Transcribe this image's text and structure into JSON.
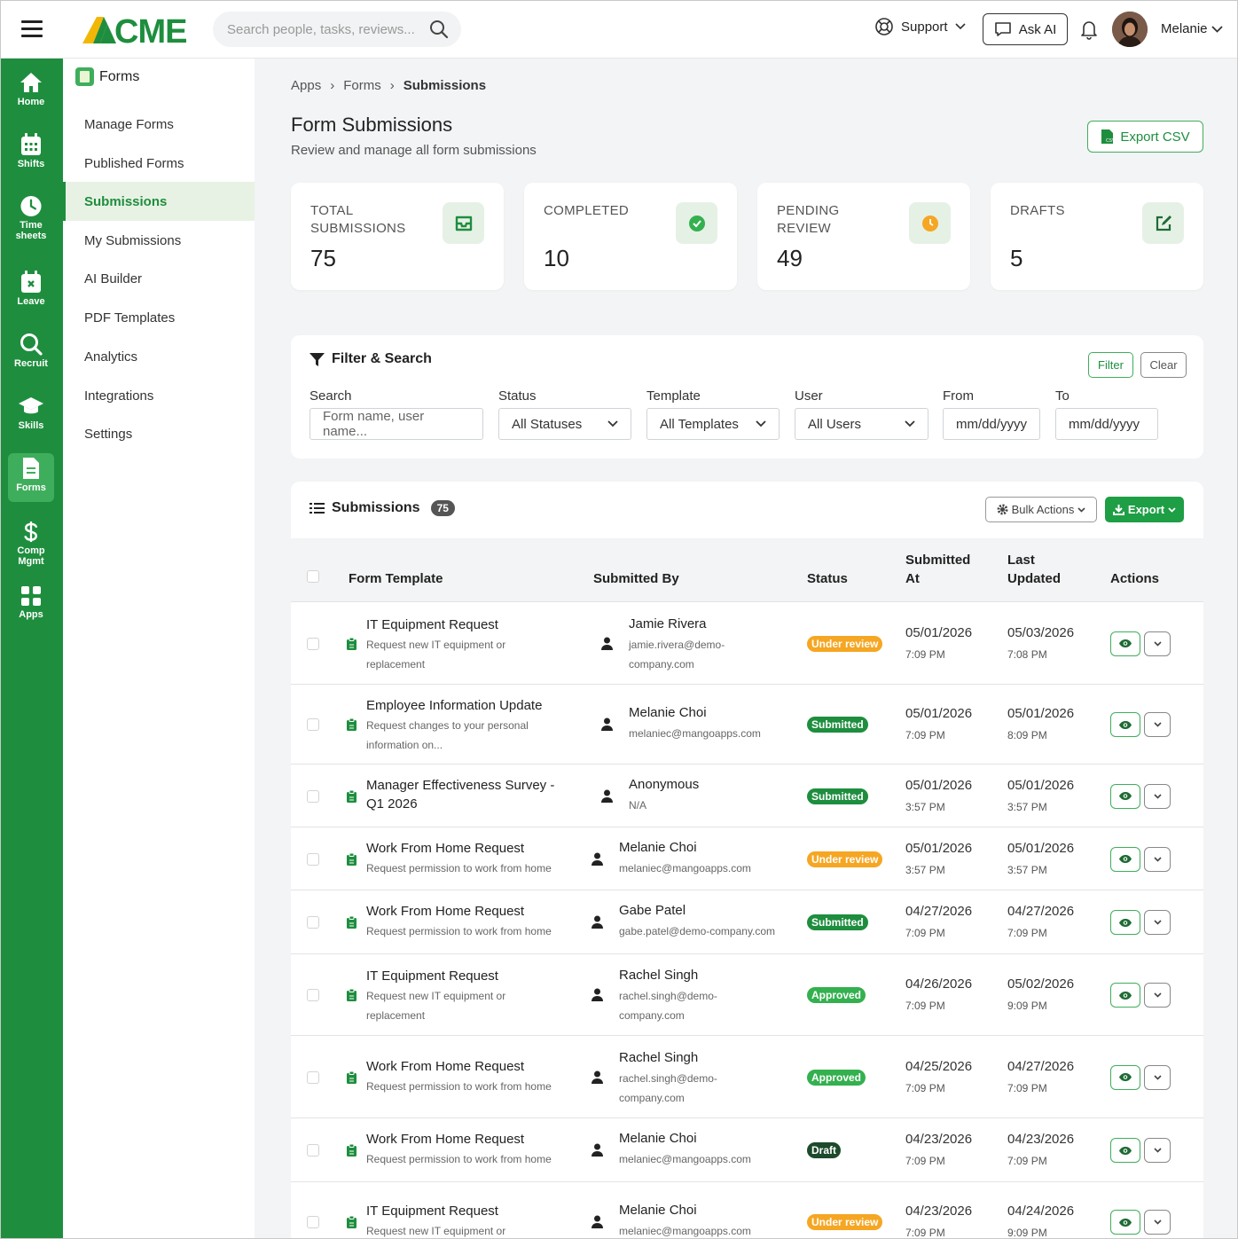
{
  "brand": {
    "logo_text": "ACME"
  },
  "topbar": {
    "search_placeholder": "Search people, tasks, reviews...",
    "support_label": "Support",
    "ask_ai_label": "Ask AI",
    "user_name": "Melanie"
  },
  "rail": [
    {
      "label": "Home",
      "icon": "home-icon"
    },
    {
      "label": "Shifts",
      "icon": "calendar-icon"
    },
    {
      "label": "Time sheets",
      "icon": "clock-icon"
    },
    {
      "label": "Leave",
      "icon": "calendar-x-icon"
    },
    {
      "label": "Recruit",
      "icon": "search-icon"
    },
    {
      "label": "Skills",
      "icon": "graduation-cap-icon"
    },
    {
      "label": "Forms",
      "icon": "form-icon",
      "active": true
    },
    {
      "label": "Comp Mgmt",
      "icon": "dollar-icon"
    },
    {
      "label": "Apps",
      "icon": "grid-icon"
    }
  ],
  "sidebar": {
    "title": "Forms",
    "items": [
      {
        "label": "Manage Forms"
      },
      {
        "label": "Published Forms"
      },
      {
        "label": "Submissions",
        "active": true
      },
      {
        "label": "My Submissions"
      },
      {
        "label": "AI Builder"
      },
      {
        "label": "PDF Templates"
      },
      {
        "label": "Analytics"
      },
      {
        "label": "Integrations"
      },
      {
        "label": "Settings"
      }
    ]
  },
  "breadcrumb": [
    "Apps",
    "Forms",
    "Submissions"
  ],
  "page": {
    "title": "Form Submissions",
    "subtitle": "Review and manage all form submissions",
    "export_csv_label": "Export CSV"
  },
  "stats": [
    {
      "label": "TOTAL SUBMISSIONS",
      "value": "75",
      "icon": "inbox-icon",
      "color": "#1e8e3e"
    },
    {
      "label": "COMPLETED",
      "value": "10",
      "icon": "check-circle-icon",
      "color": "#34b04f"
    },
    {
      "label": "PENDING REVIEW",
      "value": "49",
      "icon": "clock-icon",
      "color": "#f5a623"
    },
    {
      "label": "DRAFTS",
      "value": "5",
      "icon": "edit-icon",
      "color": "#1e6b34"
    }
  ],
  "filter": {
    "title": "Filter & Search",
    "filter_button": "Filter",
    "clear_button": "Clear",
    "search_label": "Search",
    "search_placeholder": "Form name, user name...",
    "status_label": "Status",
    "status_value": "All Statuses",
    "template_label": "Template",
    "template_value": "All Templates",
    "user_label": "User",
    "user_value": "All Users",
    "from_label": "From",
    "from_placeholder": "mm/dd/yyyy",
    "to_label": "To",
    "to_placeholder": "mm/dd/yyyy"
  },
  "submissions": {
    "title": "Submissions",
    "count": "75",
    "bulk_actions_label": "Bulk Actions",
    "export_label": "Export",
    "columns": {
      "form_template": "Form Template",
      "submitted_by": "Submitted By",
      "status": "Status",
      "submitted_at_1": "Submitted",
      "submitted_at_2": "At",
      "last_updated_1": "Last",
      "last_updated_2": "Updated",
      "actions": "Actions"
    },
    "rows": [
      {
        "title": "IT Equipment Request",
        "desc1": "Request new IT equipment or",
        "desc2": "replacement",
        "user": "Jamie Rivera",
        "email1": "jamie.rivera@demo-",
        "email2": "company.com",
        "status": "Under review",
        "status_kind": "review",
        "sub_date": "05/01/2026",
        "sub_time": "7:09 PM",
        "upd_date": "05/03/2026",
        "upd_time": "7:08 PM"
      },
      {
        "title": "Employee Information Update",
        "desc1": "Request changes to your personal",
        "desc2": "information on...",
        "user": "Melanie Choi",
        "email1": "melaniec@mangoapps.com",
        "email2": "",
        "status": "Submitted",
        "status_kind": "submitted",
        "sub_date": "05/01/2026",
        "sub_time": "7:09 PM",
        "upd_date": "05/01/2026",
        "upd_time": "8:09 PM"
      },
      {
        "title": "Manager Effectiveness Survey -",
        "title2": "Q1 2026",
        "desc1": "",
        "desc2": "",
        "user": "Anonymous",
        "email1": "N/A",
        "email2": "",
        "status": "Submitted",
        "status_kind": "submitted",
        "sub_date": "05/01/2026",
        "sub_time": "3:57 PM",
        "upd_date": "05/01/2026",
        "upd_time": "3:57 PM"
      },
      {
        "title": "Work From Home Request",
        "desc1": "Request permission to work from home",
        "desc2": "",
        "user": "Melanie Choi",
        "email1": "melaniec@mangoapps.com",
        "email2": "",
        "status": "Under review",
        "status_kind": "review",
        "sub_date": "05/01/2026",
        "sub_time": "3:57 PM",
        "upd_date": "05/01/2026",
        "upd_time": "3:57 PM"
      },
      {
        "title": "Work From Home Request",
        "desc1": "Request permission to work from home",
        "desc2": "",
        "user": "Gabe Patel",
        "email1": "gabe.patel@demo-company.com",
        "email2": "",
        "status": "Submitted",
        "status_kind": "submitted",
        "sub_date": "04/27/2026",
        "sub_time": "7:09 PM",
        "upd_date": "04/27/2026",
        "upd_time": "7:09 PM"
      },
      {
        "title": "IT Equipment Request",
        "desc1": "Request new IT equipment or",
        "desc2": "replacement",
        "user": "Rachel Singh",
        "email1": "rachel.singh@demo-",
        "email2": "company.com",
        "status": "Approved",
        "status_kind": "approved",
        "sub_date": "04/26/2026",
        "sub_time": "7:09 PM",
        "upd_date": "05/02/2026",
        "upd_time": "9:09 PM"
      },
      {
        "title": "Work From Home Request",
        "desc1": "Request permission to work from home",
        "desc2": "",
        "user": "Rachel Singh",
        "email1": "rachel.singh@demo-",
        "email2": "company.com",
        "status": "Approved",
        "status_kind": "approved",
        "sub_date": "04/25/2026",
        "sub_time": "7:09 PM",
        "upd_date": "04/27/2026",
        "upd_time": "7:09 PM"
      },
      {
        "title": "Work From Home Request",
        "desc1": "Request permission to work from home",
        "desc2": "",
        "user": "Melanie Choi",
        "email1": "melaniec@mangoapps.com",
        "email2": "",
        "status": "Draft",
        "status_kind": "draft",
        "sub_date": "04/23/2026",
        "sub_time": "7:09 PM",
        "upd_date": "04/23/2026",
        "upd_time": "7:09 PM"
      },
      {
        "title": "IT Equipment Request",
        "desc1": "Request new IT equipment or",
        "desc2": "",
        "user": "Melanie Choi",
        "email1": "melaniec@mangoapps.com",
        "email2": "",
        "status": "Under review",
        "status_kind": "review",
        "sub_date": "04/23/2026",
        "sub_time": "7:09 PM",
        "upd_date": "04/24/2026",
        "upd_time": "9:09 PM"
      }
    ]
  }
}
